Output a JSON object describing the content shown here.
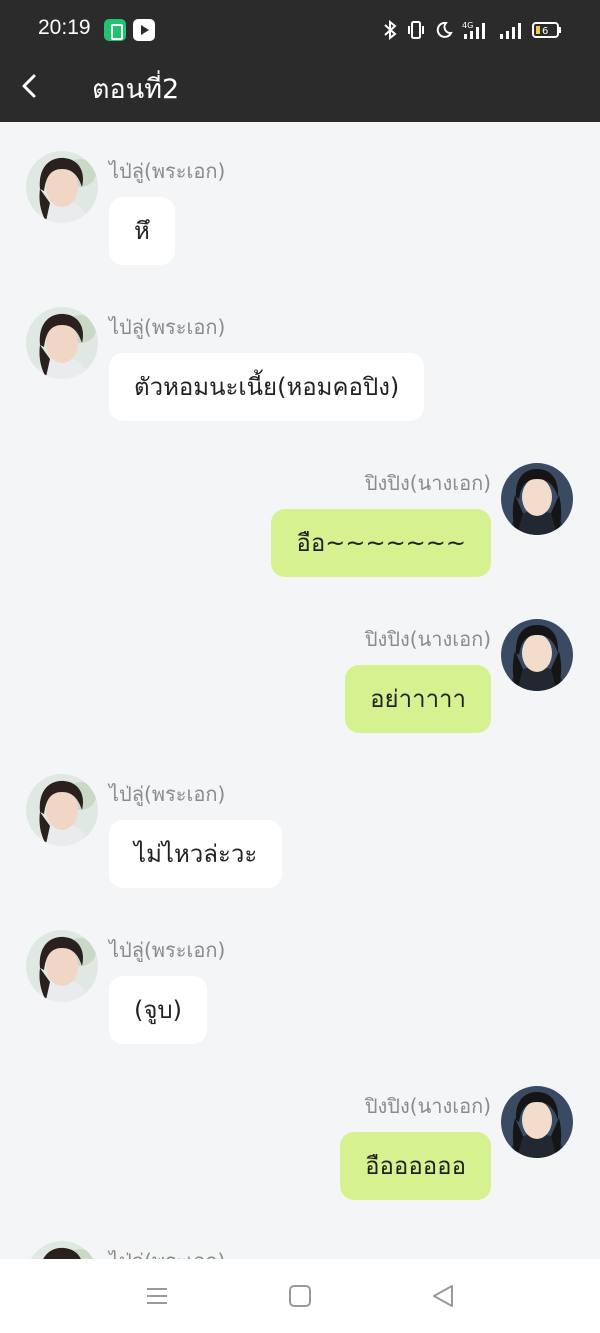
{
  "status_bar": {
    "time": "20:19",
    "battery_level": "6",
    "icons": [
      "battery-saver-app-icon",
      "video-app-icon",
      "bluetooth-icon",
      "vibrate-icon",
      "do-not-disturb-moon-icon",
      "4g-signal-icon",
      "signal-icon",
      "battery-icon"
    ]
  },
  "header": {
    "title": "ตอนที่2",
    "back_icon": "chevron-left-icon"
  },
  "messages": [
    {
      "side": "incoming",
      "sender": "ไป่ลู่(พระเอก)",
      "text": "หึ"
    },
    {
      "side": "incoming",
      "sender": "ไป่ลู่(พระเอก)",
      "text": "ตัวหอมนะเนี้ย(หอมคอปิง)"
    },
    {
      "side": "outgoing",
      "sender": "ปิงปิง(นางเอก)",
      "text": "อือ~~~~~~~"
    },
    {
      "side": "outgoing",
      "sender": "ปิงปิง(นางเอก)",
      "text": "อย่าาาาา"
    },
    {
      "side": "incoming",
      "sender": "ไป่ลู่(พระเอก)",
      "text": "ไม่ไหวล่ะวะ"
    },
    {
      "side": "incoming",
      "sender": "ไป่ลู่(พระเอก)",
      "text": "(จูบ)"
    },
    {
      "side": "outgoing",
      "sender": "ปิงปิง(นางเอก)",
      "text": "อืออออออ"
    },
    {
      "side": "incoming",
      "sender": "ไป่ลู่(พระเอก)",
      "text": ""
    }
  ],
  "nav_bar": {
    "icons": [
      "menu-icon",
      "home-square-icon",
      "back-triangle-icon"
    ]
  },
  "colors": {
    "top_bar": "#2b2b2b",
    "chat_background": "#f4f5f7",
    "incoming_bubble": "#ffffff",
    "outgoing_bubble": "#d6f18f",
    "sender_name": "#8b8b8b"
  }
}
